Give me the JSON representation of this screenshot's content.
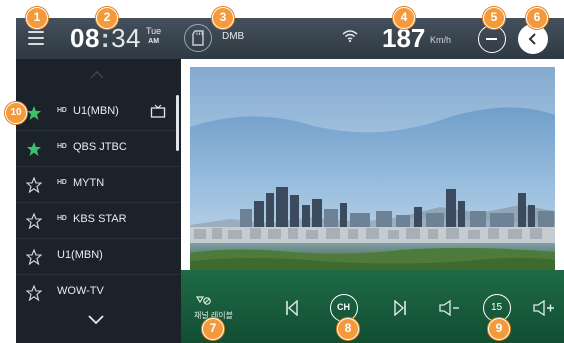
{
  "status_bar": {
    "clock_hours": "08",
    "clock_sep": ":",
    "clock_minutes": "34",
    "day": "Tue",
    "ampm": "AM",
    "source_label": "DMB",
    "speed_value": "187",
    "speed_unit": "Km/h"
  },
  "channel_list": {
    "items": [
      {
        "hd": "HD",
        "name": "U1(MBN)",
        "favorite": true
      },
      {
        "hd": "HD",
        "name": "QBS JTBC",
        "favorite": true
      },
      {
        "hd": "HD",
        "name": "MYTN",
        "favorite": false
      },
      {
        "hd": "HD",
        "name": "KBS STAR",
        "favorite": false
      },
      {
        "hd": "",
        "name": "U1(MBN)",
        "favorite": false
      },
      {
        "hd": "",
        "name": "WOW-TV",
        "favorite": false
      }
    ]
  },
  "controls": {
    "sleep_label": "채널 레이블",
    "ch_label": "CH",
    "volume_level": "15"
  },
  "callouts": [
    "1",
    "2",
    "3",
    "4",
    "5",
    "6",
    "7",
    "8",
    "9",
    "10"
  ],
  "colors": {
    "topbar": "#3a4550",
    "sidebar": "#1b2229",
    "favorite_star": "#3fbf6a",
    "control_bar": "#1a6040",
    "callout": "#f39a3c"
  }
}
